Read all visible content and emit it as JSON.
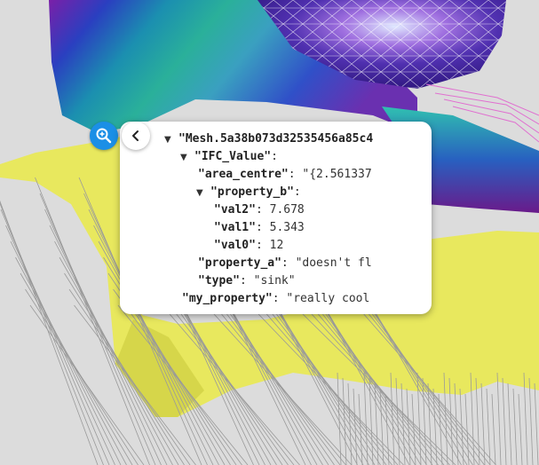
{
  "tree": {
    "root_key": "\"Mesh.5a38b073d32535456a85c4",
    "ifc_key": "\"IFC_Value\"",
    "ifc_colon": ":",
    "area_centre_key": "\"area_centre\"",
    "area_centre_sep": ": ",
    "area_centre_value": "\"{2.561337",
    "property_b_key": "\"property_b\"",
    "property_b_colon": ":",
    "val2_key": "\"val2\"",
    "val2_sep": ": ",
    "val2_value": "7.678",
    "val1_key": "\"val1\"",
    "val1_sep": ": ",
    "val1_value": "5.343",
    "val0_key": "\"val0\"",
    "val0_sep": ": ",
    "val0_value": "12",
    "property_a_key": "\"property_a\"",
    "property_a_sep": ": ",
    "property_a_value": "\"doesn't fl",
    "type_key": "\"type\"",
    "type_sep": ": ",
    "type_value": "\"sink\"",
    "my_property_key": "\"my_property\"",
    "my_property_sep": ": ",
    "my_property_value": "\"really cool",
    "expanded_glyph": "▼"
  },
  "icons": {
    "zoom": "zoom-in-icon",
    "back": "chevron-left-icon"
  },
  "colors": {
    "zoom_button": "#1b8fe6",
    "yellow_mesh": "#e8e85e",
    "panel_bg": "#ffffff"
  }
}
